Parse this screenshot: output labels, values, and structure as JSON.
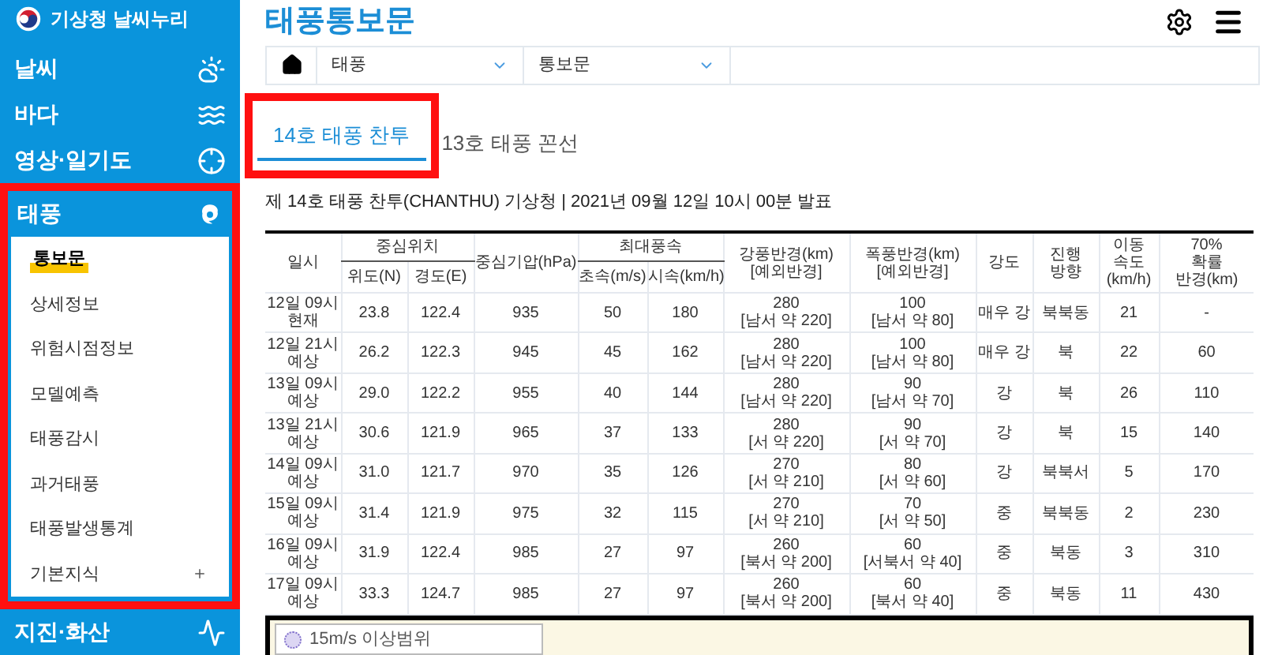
{
  "sidebar": {
    "logo": "기상청 날씨누리",
    "sections": [
      {
        "label": "날씨",
        "kind": "weather",
        "expanded": false,
        "highlighted": false
      },
      {
        "label": "바다",
        "kind": "sea",
        "expanded": false,
        "highlighted": false
      },
      {
        "label": "영상·일기도",
        "kind": "imagery",
        "expanded": false,
        "highlighted": false
      },
      {
        "label": "태풍",
        "kind": "typhoon",
        "expanded": true,
        "highlighted": true,
        "children": [
          {
            "label": "통보문",
            "selected": true
          },
          {
            "label": "상세정보",
            "selected": false
          },
          {
            "label": "위험시점정보",
            "selected": false
          },
          {
            "label": "모델예측",
            "selected": false
          },
          {
            "label": "태풍감시",
            "selected": false
          },
          {
            "label": "과거태풍",
            "selected": false
          },
          {
            "label": "태풍발생통계",
            "selected": false
          },
          {
            "label": "기본지식",
            "selected": false,
            "expandable": true
          }
        ]
      },
      {
        "label": "지진·화산",
        "kind": "quake",
        "expanded": false,
        "highlighted": false
      }
    ]
  },
  "page_title": "태풍통보문",
  "breadcrumb": [
    {
      "kind": "home"
    },
    {
      "label": "태풍",
      "kind": "select"
    },
    {
      "label": "통보문",
      "kind": "select"
    }
  ],
  "tabs": [
    {
      "label": "14호 태풍 찬투",
      "selected": true,
      "highlighted": true
    },
    {
      "label": "13호 태풍 꼰선",
      "selected": false,
      "highlighted": false
    }
  ],
  "caption": "제 14호 태풍 찬투(CHANTHU) 기상청 | 2021년 09월 12일 10시 00분 발표",
  "table": {
    "header_rows": [
      [
        {
          "label": "일시",
          "rowspan": 2
        },
        {
          "label": "중심위치",
          "colspan": 2
        },
        {
          "label": "중심기압(hPa)",
          "rowspan": 2
        },
        {
          "label": "최대풍속",
          "colspan": 2
        },
        {
          "label": "강풍반경(km)\n[예외반경]",
          "rowspan": 2
        },
        {
          "label": "폭풍반경(km)\n[예외반경]",
          "rowspan": 2
        },
        {
          "label": "강도",
          "rowspan": 2
        },
        {
          "label": "진행\n방향",
          "rowspan": 2
        },
        {
          "label": "이동\n속도\n(km/h)",
          "rowspan": 2
        },
        {
          "label": "70%\n확률\n반경(km)",
          "rowspan": 2
        }
      ],
      [
        {
          "label": "위도(N)"
        },
        {
          "label": "경도(E)"
        },
        {
          "label": "초속(m/s)"
        },
        {
          "label": "시속(km/h)"
        }
      ]
    ],
    "rows": [
      [
        "12일 09시\n현재",
        "23.8",
        "122.4",
        "935",
        "50",
        "180",
        "280\n[남서 약 220]",
        "100\n[남서 약 80]",
        "매우 강",
        "북북동",
        "21",
        "-"
      ],
      [
        "12일 21시\n예상",
        "26.2",
        "122.3",
        "945",
        "45",
        "162",
        "280\n[남서 약 220]",
        "100\n[남서 약 80]",
        "매우 강",
        "북",
        "22",
        "60"
      ],
      [
        "13일 09시\n예상",
        "29.0",
        "122.2",
        "955",
        "40",
        "144",
        "280\n[남서 약 220]",
        "90\n[남서 약 70]",
        "강",
        "북",
        "26",
        "110"
      ],
      [
        "13일 21시\n예상",
        "30.6",
        "121.9",
        "965",
        "37",
        "133",
        "280\n[서 약 220]",
        "90\n[서 약 70]",
        "강",
        "북",
        "15",
        "140"
      ],
      [
        "14일 09시\n예상",
        "31.0",
        "121.7",
        "970",
        "35",
        "126",
        "270\n[서 약 210]",
        "80\n[서 약 60]",
        "강",
        "북북서",
        "5",
        "170"
      ],
      [
        "15일 09시\n예상",
        "31.4",
        "121.9",
        "975",
        "32",
        "115",
        "270\n[서 약 210]",
        "70\n[서 약 50]",
        "중",
        "북북동",
        "2",
        "230"
      ],
      [
        "16일 09시\n예상",
        "31.9",
        "122.4",
        "985",
        "27",
        "97",
        "260\n[북서 약 200]",
        "60\n[서북서 약 40]",
        "중",
        "북동",
        "3",
        "310"
      ],
      [
        "17일 09시\n예상",
        "33.3",
        "124.7",
        "985",
        "27",
        "97",
        "260\n[북서 약 200]",
        "60\n[북서 약 40]",
        "중",
        "북동",
        "11",
        "430"
      ]
    ]
  },
  "map": {
    "legend": "15m/s 이상범위"
  }
}
